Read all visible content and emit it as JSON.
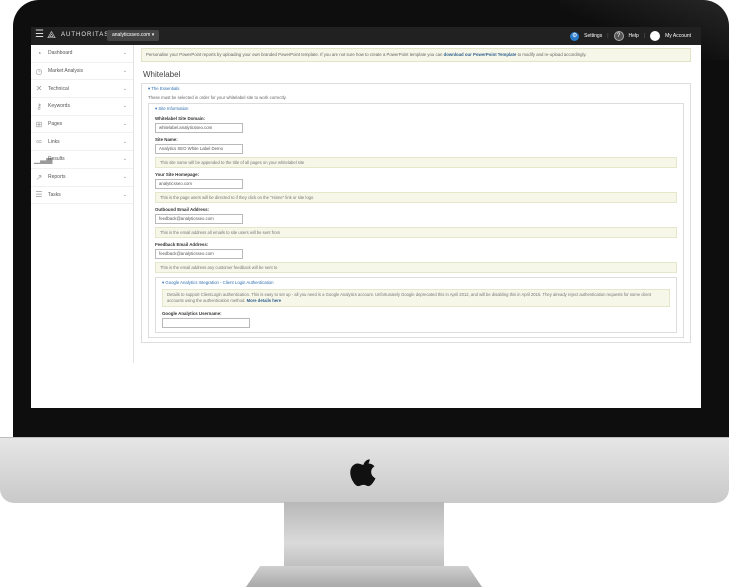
{
  "topbar": {
    "brand": "AUTHORITAS",
    "domain": "analyticsseo.com ▾",
    "settings": "Settings",
    "help": "Help",
    "account": "My Account"
  },
  "sidebar": {
    "items": [
      {
        "label": "Dashboard",
        "icon": "dashboard-icon"
      },
      {
        "label": "Market Analysis",
        "icon": "market-analysis-icon"
      },
      {
        "label": "Technical",
        "icon": "technical-icon"
      },
      {
        "label": "Keywords",
        "icon": "keywords-icon"
      },
      {
        "label": "Pages",
        "icon": "pages-icon"
      },
      {
        "label": "Links",
        "icon": "links-icon"
      },
      {
        "label": "Results",
        "icon": "results-icon"
      },
      {
        "label": "Reports",
        "icon": "reports-icon"
      },
      {
        "label": "Tasks",
        "icon": "tasks-icon"
      }
    ]
  },
  "notice": {
    "text": "Personalise your PowerPoint reports by uploading your own branded PowerPoint template. If you are not sure how to create a PowerPoint template you can",
    "link": "download our PowerPoint Template",
    "tail": "to modify and re-upload accordingly."
  },
  "page_title": "Whitelabel",
  "essentials": {
    "legend": "▾ The Essentials",
    "description": "These must be selected in order for your whitelabel site to work correctly."
  },
  "site_info": {
    "legend": "▾ Site Information",
    "domain_label": "Whitelabel Site Domain:",
    "domain_value": "whitelabel.analyticsseo.com",
    "name_label": "Site Name:",
    "name_value": "Analytics SEO White Label Demo",
    "name_hint": "This site name will be appended to the title of all pages on your whitelabel site",
    "homepage_label": "Your Site Homepage:",
    "homepage_value": "analyticsseo.com",
    "homepage_hint": "This is the page users will be directed to if they click on the \"Home\" link or site logo",
    "outbound_label": "Outbound Email Address:",
    "outbound_value": "feedback@analyticsseo.com",
    "outbound_hint": "This is the email address all emails to site users will be sent from",
    "feedback_label": "Feedback Email Address:",
    "feedback_value": "feedback@analyticsseo.com",
    "feedback_hint": "This is the email address any customer feedback will be sent to"
  },
  "google": {
    "legend": "▾ Google Analytics Integration - Client Login Authentication",
    "details": "Details to support ClientLogin authentication. This is easy to set up - all you need is a Google Analytics account. Unfortunately Google deprecated this in April 2012, and will be disabling this in April 2015. They already reject authentication requests for some client accounts using the authentication method.",
    "details_link": "More details here",
    "username_label": "Google Analytics Username:",
    "username_value": ""
  }
}
